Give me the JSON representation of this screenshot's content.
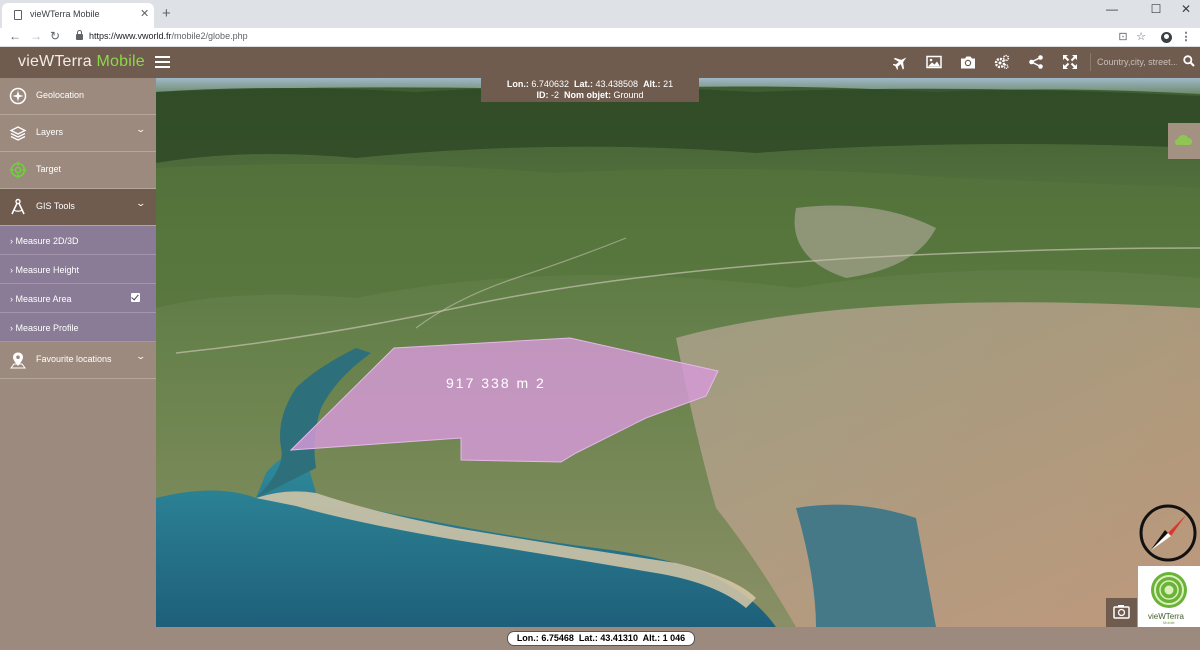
{
  "browser": {
    "tab_title": "vieWTerra Mobile",
    "tab_close": "✕",
    "new_tab": "+",
    "url_host": "https://www.vworld.fr",
    "url_path": "/mobile2/globe.php",
    "window_controls": {
      "minimize": "—",
      "maximize": "☐",
      "close": "✕"
    },
    "nav": {
      "back": "←",
      "forward": "→",
      "reload": "↻"
    }
  },
  "header": {
    "brand_main": "vieWTerra",
    "brand_accent": "Mobile",
    "search_placeholder": "Country,city, street...",
    "icons": [
      "plane-icon",
      "image-icon",
      "camera-icon",
      "gears-icon",
      "share-icon",
      "fullscreen-icon",
      "search-icon"
    ]
  },
  "sidebar": {
    "items": [
      {
        "label": "Geolocation",
        "icon": "geolocation-icon"
      },
      {
        "label": "Layers",
        "icon": "layers-icon",
        "chevron": true
      },
      {
        "label": "Target",
        "icon": "target-icon"
      },
      {
        "label": "GIS Tools",
        "icon": "gis-compass-icon",
        "chevron": true,
        "active": true
      },
      {
        "label": "Favourite locations",
        "icon": "map-pin-icon",
        "chevron": true
      }
    ],
    "sub_items": [
      {
        "label": "› Measure 2D/3D"
      },
      {
        "label": "› Measure Height"
      },
      {
        "label": "› Measure Area",
        "checked": true
      },
      {
        "label": "› Measure Profile"
      }
    ]
  },
  "viewport": {
    "info": {
      "lon_label": "Lon.:",
      "lon": "6.740632",
      "lat_label": "Lat.:",
      "lat": "43.438508",
      "alt_label": "Alt.:",
      "alt": "21",
      "id_label": "ID:",
      "id": "-2",
      "name_label": "Nom objet:",
      "name": "Ground"
    },
    "area_measure": "917 338 m 2",
    "logo_text": "vieWTerra",
    "logo_sub": "Mobile",
    "area_fill": "#d79ad9"
  },
  "status": {
    "lon_label": "Lon.:",
    "lon": "6.75468",
    "lat_label": "Lat.:",
    "lat": "43.41310",
    "alt_label": "Alt.:",
    "alt": "1 046"
  }
}
